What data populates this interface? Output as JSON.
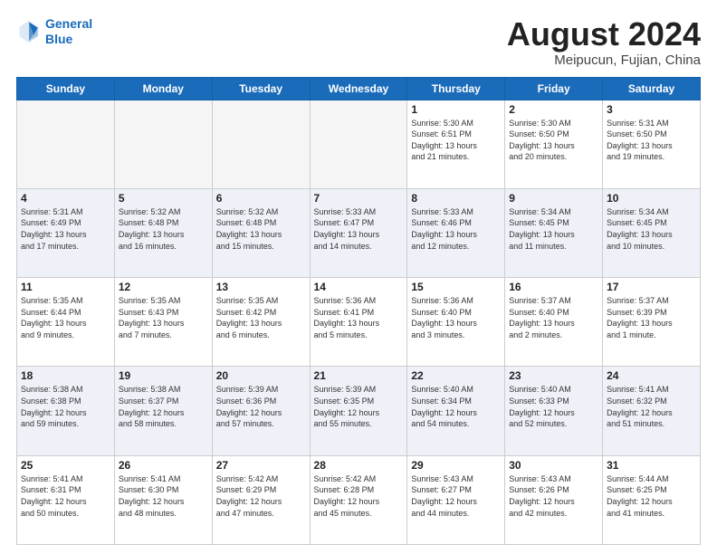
{
  "header": {
    "logo_line1": "General",
    "logo_line2": "Blue",
    "month": "August 2024",
    "location": "Meipucun, Fujian, China"
  },
  "days_of_week": [
    "Sunday",
    "Monday",
    "Tuesday",
    "Wednesday",
    "Thursday",
    "Friday",
    "Saturday"
  ],
  "weeks": [
    [
      {
        "day": "",
        "info": ""
      },
      {
        "day": "",
        "info": ""
      },
      {
        "day": "",
        "info": ""
      },
      {
        "day": "",
        "info": ""
      },
      {
        "day": "1",
        "info": "Sunrise: 5:30 AM\nSunset: 6:51 PM\nDaylight: 13 hours\nand 21 minutes."
      },
      {
        "day": "2",
        "info": "Sunrise: 5:30 AM\nSunset: 6:50 PM\nDaylight: 13 hours\nand 20 minutes."
      },
      {
        "day": "3",
        "info": "Sunrise: 5:31 AM\nSunset: 6:50 PM\nDaylight: 13 hours\nand 19 minutes."
      }
    ],
    [
      {
        "day": "4",
        "info": "Sunrise: 5:31 AM\nSunset: 6:49 PM\nDaylight: 13 hours\nand 17 minutes."
      },
      {
        "day": "5",
        "info": "Sunrise: 5:32 AM\nSunset: 6:48 PM\nDaylight: 13 hours\nand 16 minutes."
      },
      {
        "day": "6",
        "info": "Sunrise: 5:32 AM\nSunset: 6:48 PM\nDaylight: 13 hours\nand 15 minutes."
      },
      {
        "day": "7",
        "info": "Sunrise: 5:33 AM\nSunset: 6:47 PM\nDaylight: 13 hours\nand 14 minutes."
      },
      {
        "day": "8",
        "info": "Sunrise: 5:33 AM\nSunset: 6:46 PM\nDaylight: 13 hours\nand 12 minutes."
      },
      {
        "day": "9",
        "info": "Sunrise: 5:34 AM\nSunset: 6:45 PM\nDaylight: 13 hours\nand 11 minutes."
      },
      {
        "day": "10",
        "info": "Sunrise: 5:34 AM\nSunset: 6:45 PM\nDaylight: 13 hours\nand 10 minutes."
      }
    ],
    [
      {
        "day": "11",
        "info": "Sunrise: 5:35 AM\nSunset: 6:44 PM\nDaylight: 13 hours\nand 9 minutes."
      },
      {
        "day": "12",
        "info": "Sunrise: 5:35 AM\nSunset: 6:43 PM\nDaylight: 13 hours\nand 7 minutes."
      },
      {
        "day": "13",
        "info": "Sunrise: 5:35 AM\nSunset: 6:42 PM\nDaylight: 13 hours\nand 6 minutes."
      },
      {
        "day": "14",
        "info": "Sunrise: 5:36 AM\nSunset: 6:41 PM\nDaylight: 13 hours\nand 5 minutes."
      },
      {
        "day": "15",
        "info": "Sunrise: 5:36 AM\nSunset: 6:40 PM\nDaylight: 13 hours\nand 3 minutes."
      },
      {
        "day": "16",
        "info": "Sunrise: 5:37 AM\nSunset: 6:40 PM\nDaylight: 13 hours\nand 2 minutes."
      },
      {
        "day": "17",
        "info": "Sunrise: 5:37 AM\nSunset: 6:39 PM\nDaylight: 13 hours\nand 1 minute."
      }
    ],
    [
      {
        "day": "18",
        "info": "Sunrise: 5:38 AM\nSunset: 6:38 PM\nDaylight: 12 hours\nand 59 minutes."
      },
      {
        "day": "19",
        "info": "Sunrise: 5:38 AM\nSunset: 6:37 PM\nDaylight: 12 hours\nand 58 minutes."
      },
      {
        "day": "20",
        "info": "Sunrise: 5:39 AM\nSunset: 6:36 PM\nDaylight: 12 hours\nand 57 minutes."
      },
      {
        "day": "21",
        "info": "Sunrise: 5:39 AM\nSunset: 6:35 PM\nDaylight: 12 hours\nand 55 minutes."
      },
      {
        "day": "22",
        "info": "Sunrise: 5:40 AM\nSunset: 6:34 PM\nDaylight: 12 hours\nand 54 minutes."
      },
      {
        "day": "23",
        "info": "Sunrise: 5:40 AM\nSunset: 6:33 PM\nDaylight: 12 hours\nand 52 minutes."
      },
      {
        "day": "24",
        "info": "Sunrise: 5:41 AM\nSunset: 6:32 PM\nDaylight: 12 hours\nand 51 minutes."
      }
    ],
    [
      {
        "day": "25",
        "info": "Sunrise: 5:41 AM\nSunset: 6:31 PM\nDaylight: 12 hours\nand 50 minutes."
      },
      {
        "day": "26",
        "info": "Sunrise: 5:41 AM\nSunset: 6:30 PM\nDaylight: 12 hours\nand 48 minutes."
      },
      {
        "day": "27",
        "info": "Sunrise: 5:42 AM\nSunset: 6:29 PM\nDaylight: 12 hours\nand 47 minutes."
      },
      {
        "day": "28",
        "info": "Sunrise: 5:42 AM\nSunset: 6:28 PM\nDaylight: 12 hours\nand 45 minutes."
      },
      {
        "day": "29",
        "info": "Sunrise: 5:43 AM\nSunset: 6:27 PM\nDaylight: 12 hours\nand 44 minutes."
      },
      {
        "day": "30",
        "info": "Sunrise: 5:43 AM\nSunset: 6:26 PM\nDaylight: 12 hours\nand 42 minutes."
      },
      {
        "day": "31",
        "info": "Sunrise: 5:44 AM\nSunset: 6:25 PM\nDaylight: 12 hours\nand 41 minutes."
      }
    ]
  ]
}
